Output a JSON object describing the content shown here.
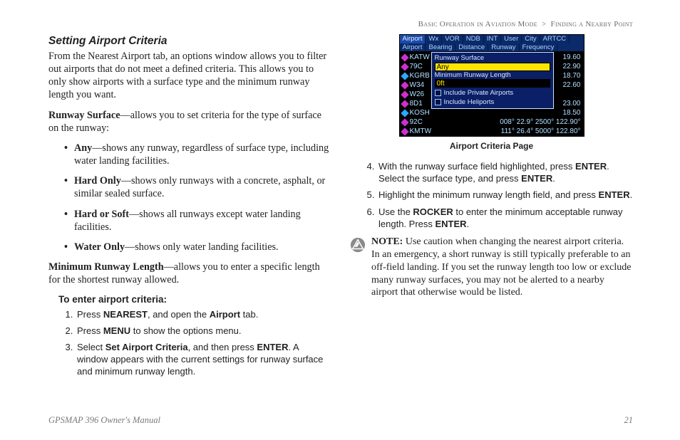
{
  "breadcrumb": {
    "a": "Basic Operation in Aviation Mode",
    "sep": ">",
    "b": "Finding a Nearby Point"
  },
  "left": {
    "heading": "Setting Airport Criteria",
    "intro": "From the Nearest Airport tab, an options window allows you to filter out airports that do not meet a defined criteria. This allows you to only show airports with a surface type and the minimum runway length you want.",
    "rs_label": "Runway Surface",
    "rs_text": "—allows you to set criteria for the type of surface on the runway:",
    "bullets": [
      {
        "b": "Any",
        "t": "—shows any runway, regardless of surface type, including water landing facilities."
      },
      {
        "b": "Hard Only",
        "t": "—shows only runways with a concrete, asphalt, or similar sealed surface."
      },
      {
        "b": "Hard or Soft",
        "t": "—shows all runways except water landing facilities."
      },
      {
        "b": "Water Only",
        "t": "—shows only water landing facilities."
      }
    ],
    "mrl_label": "Minimum Runway Length",
    "mrl_text": "—allows you to enter a specific length for the shortest runway allowed.",
    "subhead": "To enter airport criteria:",
    "steps123": [
      {
        "pre": "Press ",
        "b1": "NEAREST",
        "mid": ", and open the ",
        "b2": "Airport",
        "post": " tab."
      },
      {
        "pre": "Press ",
        "b1": "MENU",
        "mid": " to show the options menu.",
        "b2": "",
        "post": ""
      },
      {
        "pre": "Select ",
        "b1": "Set Airport Criteria",
        "mid": ", and then press ",
        "b2": "ENTER",
        "post": ". A window appears with the current settings for runway surface and minimum runway length."
      }
    ]
  },
  "screenshot": {
    "tabs1": [
      "Airport",
      "Wx",
      "VOR",
      "NDB",
      "INT",
      "User",
      "City",
      "ARTCC"
    ],
    "tabs2": [
      "Airport",
      "Bearing",
      "Distance",
      "Runway",
      "Frequency"
    ],
    "rows": [
      {
        "id": "KATW",
        "r": "19.60"
      },
      {
        "id": "79C",
        "r": "22.90"
      },
      {
        "id": "KGRB",
        "r": "18.70"
      },
      {
        "id": "W34",
        "r": "22.60"
      },
      {
        "id": "W26",
        "r": ""
      },
      {
        "id": "8D1",
        "r": "23.00"
      },
      {
        "id": "KOSH",
        "r": "18.50"
      },
      {
        "id": "92C",
        "r": "008°   22.9°   2500°   122.90°"
      },
      {
        "id": "KMTW",
        "r": "111°   26.4°   5000°   122.80°"
      }
    ],
    "popup": {
      "l1": "Runway Surface",
      "f1": "Any",
      "l2": "Minimum Runway Length",
      "f2": "0ft",
      "c1": "Include Private Airports",
      "c2": "Include Heliports"
    },
    "caption": "Airport Criteria Page"
  },
  "right": {
    "steps456": [
      {
        "pre": "With the runway surface field highlighted, press ",
        "b1": "ENTER",
        "mid": ". Select the surface type, and press ",
        "b2": "ENTER",
        "post": "."
      },
      {
        "pre": "Highlight the minimum runway length field, and press ",
        "b1": "ENTER",
        "mid": ".",
        "b2": "",
        "post": ""
      },
      {
        "pre": "Use the ",
        "b1": "ROCKER",
        "mid": " to enter the minimum acceptable runway length. Press ",
        "b2": "ENTER",
        "post": "."
      }
    ],
    "note_label": "NOTE:",
    "note": " Use caution when changing the nearest airport criteria. In an emergency, a short runway is still typically preferable to an off-field landing. If you set the runway length too low or exclude many runway surfaces, you may not be alerted to a nearby airport that otherwise would be listed."
  },
  "footer": {
    "left": "GPSMAP 396 Owner's Manual",
    "right": "21"
  }
}
